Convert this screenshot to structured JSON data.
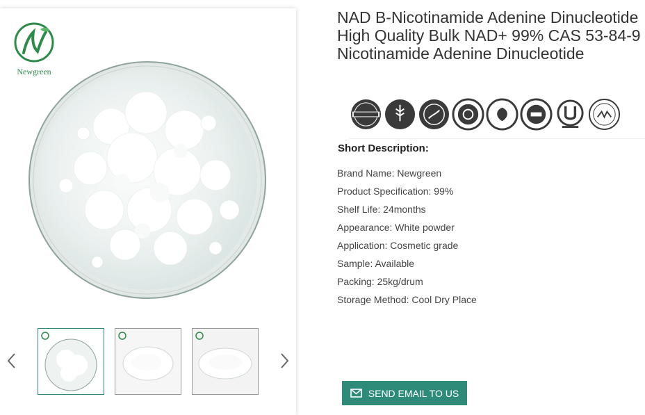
{
  "product": {
    "title": "NAD B-Nicotinamide Adenine Dinucleotide High Quality Bulk NAD+ 99% CAS 53-84-9 Nicotinamide Adenine Dinucleotide"
  },
  "brand": {
    "logo_text": "Newgreen",
    "accent": "#2e8b7a",
    "logo_green": "#2f8a4a"
  },
  "gallery": {
    "prev_icon": "chevron-left-icon",
    "next_icon": "chevron-right-icon",
    "thumbnails": [
      "thumbnail-1",
      "thumbnail-2",
      "thumbnail-3"
    ],
    "active_index": 0
  },
  "badges": [
    "natural-ingredients-badge",
    "gluten-free-badge",
    "non-gmo-badge",
    "no-preservatives-badge",
    "vegan-friendly-badge",
    "gmp-certified-badge",
    "kosher-badge",
    "sks-badge"
  ],
  "short_description": {
    "label": "Short Description:",
    "items": [
      "Brand Name: Newgreen",
      "Product Specification: 99%",
      "Shelf Life: 24months",
      "Appearance: White powder",
      "Application: Cosmetic grade",
      "Sample: Available",
      "Packing: 25kg/drum",
      "Storage Method: Cool Dry Place"
    ]
  },
  "cta": {
    "label": "SEND EMAIL TO US",
    "icon": "envelope-icon"
  }
}
